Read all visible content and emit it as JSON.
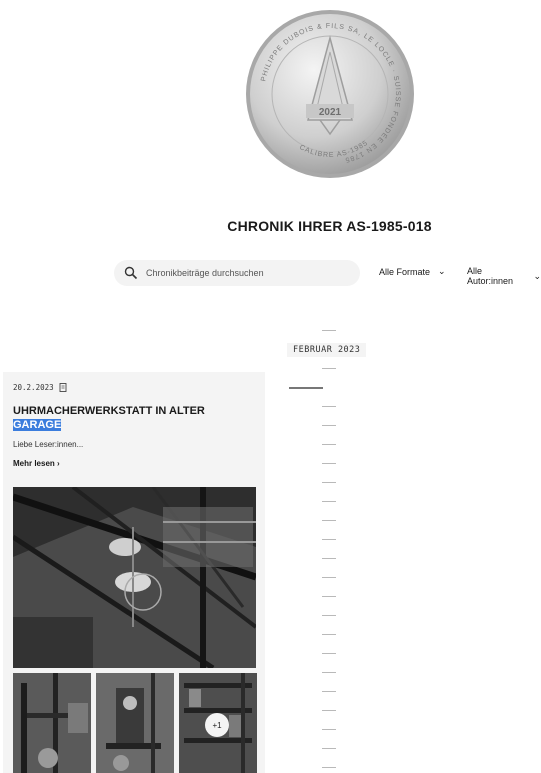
{
  "logo": {
    "ring_text": "PHILIPPE DUBOIS & FILS SA, LE LOCLE · SUISSE FONDÉE EN 1785",
    "bottom_text": "CALIBRE AS-1985",
    "year": "2021"
  },
  "page": {
    "title": "CHRONIK IHRER AS-1985-018"
  },
  "search": {
    "placeholder": "Chronikbeiträge durchsuchen",
    "icon": "search-icon"
  },
  "filters": {
    "formats_label": "Alle Formate",
    "authors_label": "Alle Autor:innen",
    "chevron": "⌄"
  },
  "timeline": {
    "month_label": "FEBRUAR 2023"
  },
  "post": {
    "date": "20.2.2023",
    "title_main": "UHRMACHERWERKSTATT IN ALTER",
    "title_highlight": "GARAGE",
    "excerpt": "Liebe Leser:innen...",
    "read_more": "Mehr lesen ›",
    "more_photos": "+1"
  },
  "colors": {
    "highlight": "#3b7ddd",
    "card_bg": "#f4f4f4"
  }
}
